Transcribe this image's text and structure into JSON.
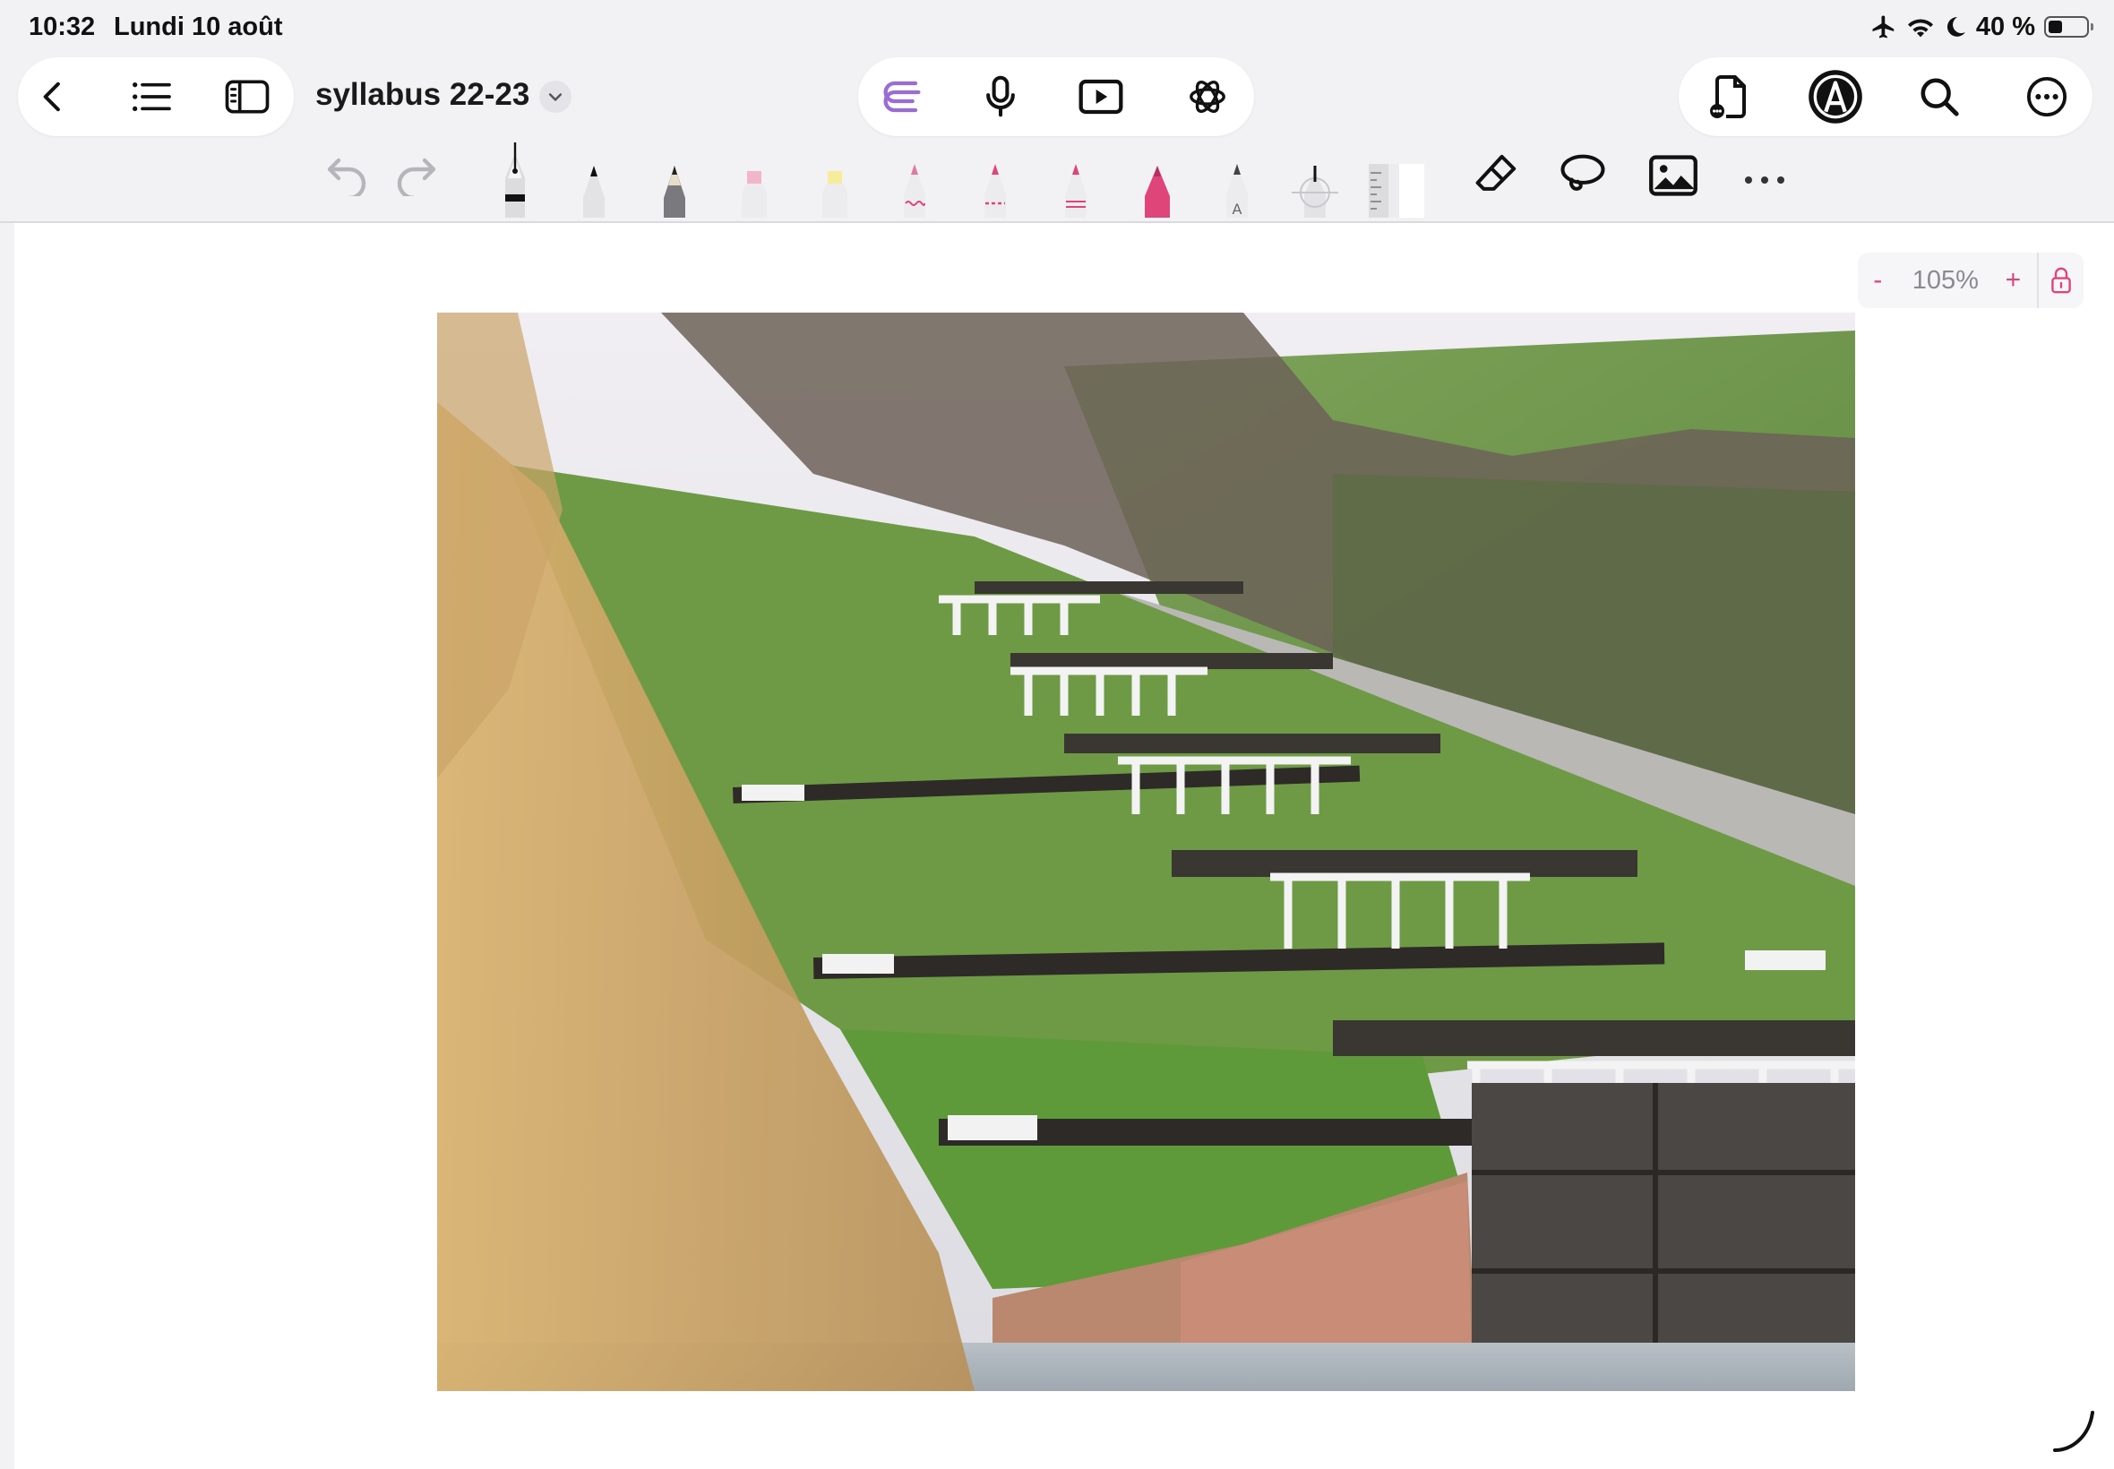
{
  "status_bar": {
    "time": "10:32",
    "date": "Lundi 10 août",
    "battery_text": "40 %",
    "battery_level": 0.4,
    "icons": [
      "airplane-icon",
      "wifi-icon",
      "moon-icon",
      "battery-icon"
    ]
  },
  "nav": {
    "back_icon": "chevron-left-icon",
    "outline_icon": "list-icon",
    "sidebar_icon": "sidebar-icon",
    "document_title": "syllabus 22-23"
  },
  "center_tools": [
    "ai-logo-icon",
    "microphone-icon",
    "presentation-icon",
    "chatgpt-icon"
  ],
  "right_tools": [
    "document-add-icon",
    "pencil-mode-icon",
    "search-icon",
    "more-icon"
  ],
  "tools": {
    "undo": "undo-icon",
    "redo": "redo-icon",
    "items": [
      "fountain-pen",
      "ballpoint-pen",
      "pencil",
      "highlighter-pink",
      "highlighter-yellow",
      "pen-wavy",
      "pen-dashed",
      "pen-double",
      "marker-pink",
      "text-pen",
      "laser-pointer",
      "ruler",
      "eraser",
      "lasso",
      "image",
      "more"
    ]
  },
  "zoom": {
    "minus": "-",
    "value": "105%",
    "plus": "+"
  },
  "colors": {
    "accent_pink": "#e0457a",
    "accent_purple": "#9b6bd6"
  }
}
